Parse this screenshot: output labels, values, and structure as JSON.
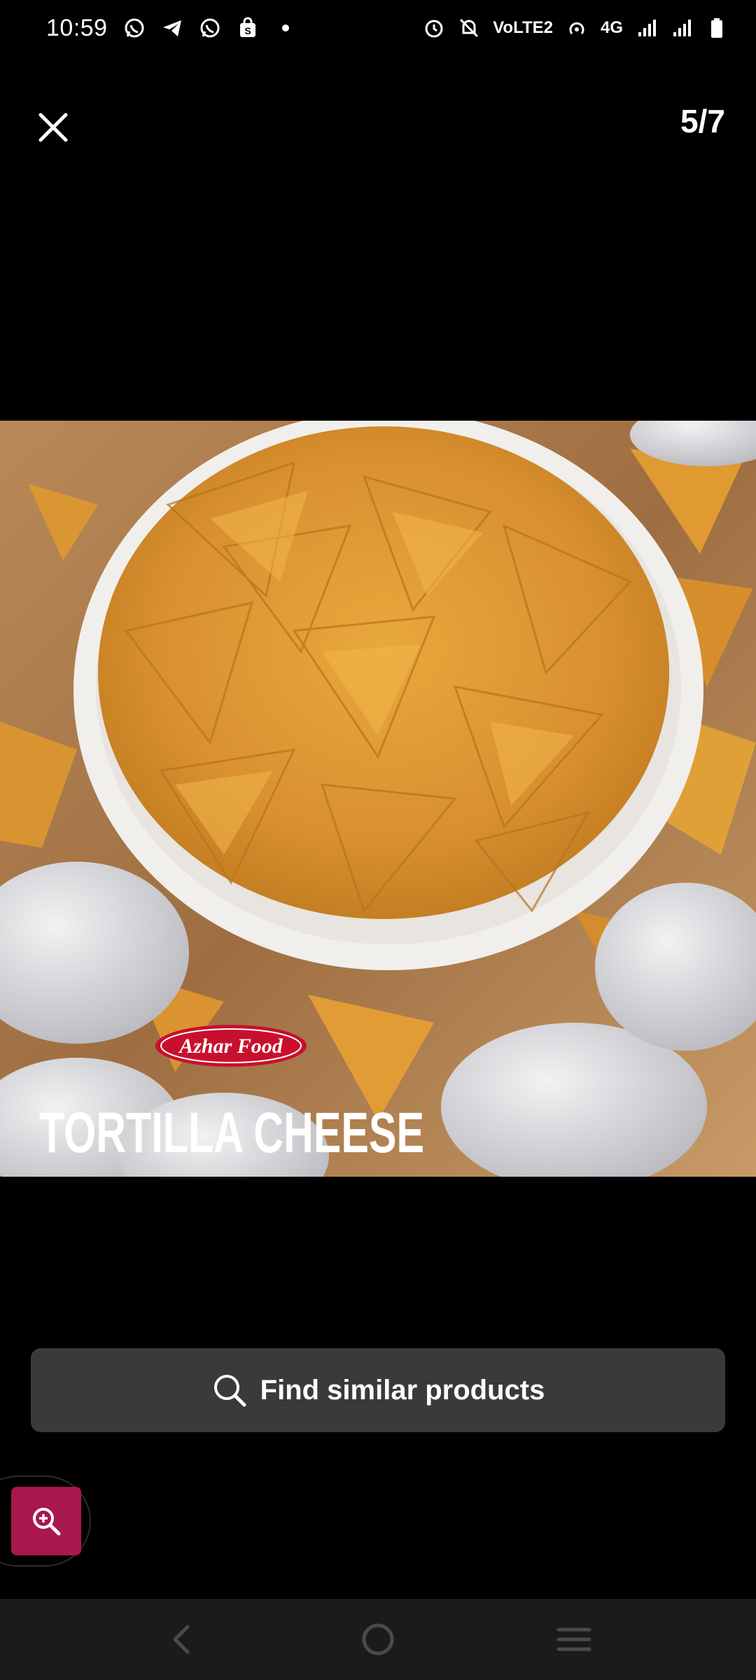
{
  "status_bar": {
    "time": "10:59",
    "network_label": "4G",
    "volte_label": "VoLTE2",
    "notification_icons": [
      "whatsapp-icon",
      "telegram-icon",
      "whatsapp-icon",
      "shopping-bag-icon",
      "dot-icon"
    ],
    "system_icons": [
      "alarm-icon",
      "bell-off-icon",
      "hotspot-icon",
      "signal-icon",
      "signal-icon",
      "battery-icon"
    ]
  },
  "viewer": {
    "counter": "5/7",
    "close_icon": "close-icon"
  },
  "image": {
    "brand_badge": "Azhar Food",
    "caption": "TORTILLA CHEESE"
  },
  "actions": {
    "find_similar_label": "Find similar products",
    "find_similar_icon": "search-icon",
    "zoom_icon": "zoom-in-icon"
  },
  "nav": {
    "back_icon": "back-icon",
    "home_icon": "home-icon",
    "recents_icon": "recents-icon"
  },
  "colors": {
    "accent": "#a8174d",
    "button_bg": "#3a3a3a",
    "nav_bg": "#1b1b1b"
  }
}
